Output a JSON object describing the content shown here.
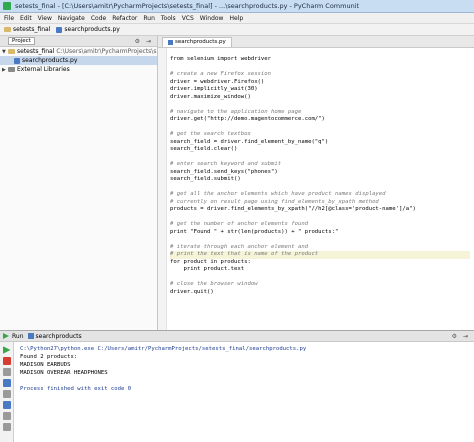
{
  "window": {
    "title": "setests_final - [C:\\Users\\amitr\\PycharmProjects\\setests_final] - ...\\searchproducts.py - PyCharm Communit"
  },
  "menu": [
    "File",
    "Edit",
    "View",
    "Navigate",
    "Code",
    "Refactor",
    "Run",
    "Tools",
    "VCS",
    "Window",
    "Help"
  ],
  "breadcrumb": {
    "project": "setests_final",
    "file": "searchproducts.py"
  },
  "project_panel": {
    "label": "Project",
    "tree": [
      {
        "name": "setests_final",
        "path": "C:\\Users\\amitr\\PycharmProjects\\s",
        "kind": "folder",
        "expanded": true
      },
      {
        "name": "searchproducts.py",
        "path": "",
        "kind": "pyfile",
        "selected": true
      },
      {
        "name": "External Libraries",
        "path": "",
        "kind": "lib",
        "expanded": false
      }
    ]
  },
  "editor": {
    "tab_label": "searchproducts.py",
    "lines": [
      {
        "text": "from selenium import webdriver",
        "kind": "code"
      },
      {
        "text": "",
        "kind": "code"
      },
      {
        "text": "# create a new Firefox session",
        "kind": "comment"
      },
      {
        "text": "driver = webdriver.Firefox()",
        "kind": "code"
      },
      {
        "text": "driver.implicitly_wait(30)",
        "kind": "code"
      },
      {
        "text": "driver.maximize_window()",
        "kind": "code"
      },
      {
        "text": "",
        "kind": "code"
      },
      {
        "text": "# navigate to the application home page",
        "kind": "comment"
      },
      {
        "text": "driver.get(\"http://demo.magentocommerce.com/\")",
        "kind": "code"
      },
      {
        "text": "",
        "kind": "code"
      },
      {
        "text": "# get the search textbox",
        "kind": "comment"
      },
      {
        "text": "search_field = driver.find_element_by_name(\"q\")",
        "kind": "code"
      },
      {
        "text": "search_field.clear()",
        "kind": "code"
      },
      {
        "text": "",
        "kind": "code"
      },
      {
        "text": "# enter search keyword and submit",
        "kind": "comment"
      },
      {
        "text": "search_field.send_keys(\"phones\")",
        "kind": "code"
      },
      {
        "text": "search_field.submit()",
        "kind": "code"
      },
      {
        "text": "",
        "kind": "code"
      },
      {
        "text": "# get all the anchor elements which have product names displayed",
        "kind": "comment"
      },
      {
        "text": "# currently on result page using find_elements_by_xpath method",
        "kind": "comment"
      },
      {
        "text": "products = driver.find_elements_by_xpath(\"//h2[@class='product-name']/a\")",
        "kind": "code"
      },
      {
        "text": "",
        "kind": "code"
      },
      {
        "text": "# get the number of anchor elements found",
        "kind": "comment"
      },
      {
        "text": "print \"Found \" + str(len(products)) + \" products:\"",
        "kind": "code"
      },
      {
        "text": "",
        "kind": "code"
      },
      {
        "text": "# iterate through each anchor element and",
        "kind": "comment"
      },
      {
        "text": "# print the text that is name of the product",
        "kind": "comment"
      },
      {
        "text": "for product in products:",
        "kind": "code"
      },
      {
        "text": "    print product.text",
        "kind": "code"
      },
      {
        "text": "",
        "kind": "code"
      },
      {
        "text": "# close the browser window",
        "kind": "comment"
      },
      {
        "text": "driver.quit()",
        "kind": "code"
      }
    ]
  },
  "run_panel": {
    "label": "Run",
    "config": "searchproducts",
    "output": [
      {
        "text": "C:\\Python27\\python.exe C:/Users/amitr/PycharmProjects/setests_final/searchproducts.py",
        "kind": "cmd"
      },
      {
        "text": "Found 2 products:",
        "kind": "out"
      },
      {
        "text": "MADISON EARBUDS",
        "kind": "out"
      },
      {
        "text": "MADISON OVEREAR HEADPHONES",
        "kind": "out"
      },
      {
        "text": "Process finished with exit code 0",
        "kind": "exit"
      }
    ]
  }
}
